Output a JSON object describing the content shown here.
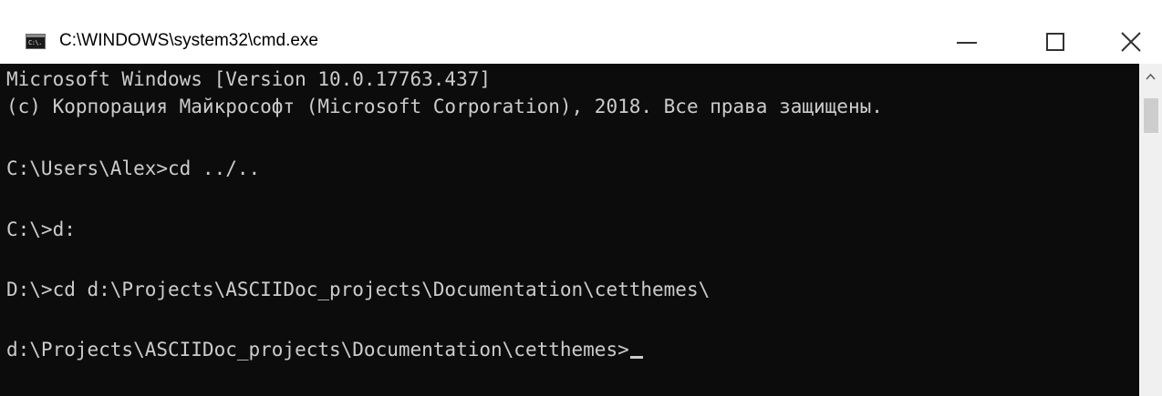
{
  "window": {
    "title": "C:\\WINDOWS\\system32\\cmd.exe",
    "icon": "console-icon",
    "icon_label": "C:\\."
  },
  "caption_buttons": {
    "minimize": "minimize-icon",
    "maximize": "maximize-icon",
    "close": "close-icon"
  },
  "console": {
    "background": "#0c0c0c",
    "foreground": "#cccccc",
    "lines": [
      "Microsoft Windows [Version 10.0.17763.437]",
      "(c) Корпорация Майкрософт (Microsoft Corporation), 2018. Все права защищены.",
      "",
      "C:\\Users\\Alex>cd ../..",
      "",
      "C:\\>d:",
      "",
      "D:\\>cd d:\\Projects\\ASCIIDoc_projects\\Documentation\\cetthemes\\",
      "",
      "d:\\Projects\\ASCIIDoc_projects\\Documentation\\cetthemes>"
    ]
  },
  "scrollbar": {
    "up_arrow": "chevron-up-icon"
  }
}
